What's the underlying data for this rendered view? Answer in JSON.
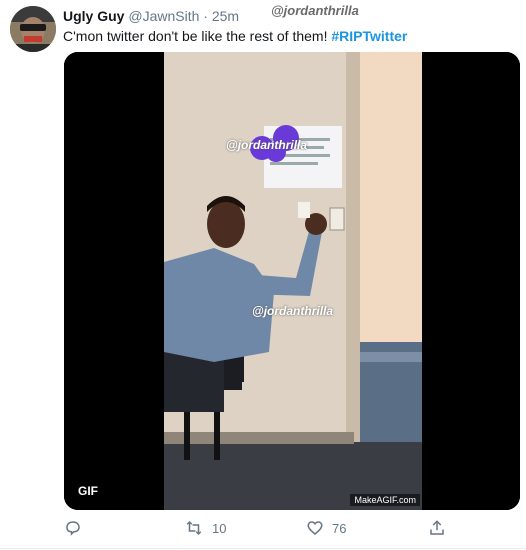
{
  "tweet": {
    "display_name": "Ugly Guy",
    "handle": "@JawnSith",
    "separator": "·",
    "time": "25m",
    "text": "C'mon twitter don't be like the rest of them!",
    "hashtag": "#RIPTwitter",
    "overlay_watermark": "@jordanthrilla"
  },
  "media": {
    "gif_label": "GIF",
    "source_label": "MakeAGIF.com",
    "watermark_upper": "@jordanthrilla",
    "watermark_lower": "@jordanthrilla"
  },
  "actions": {
    "reply_icon": "reply-icon",
    "retweet_icon": "retweet-icon",
    "retweet_count": "10",
    "like_icon": "heart-icon",
    "like_count": "76",
    "share_icon": "share-icon"
  },
  "colors": {
    "link": "#1b95e0",
    "muted": "#657786"
  }
}
